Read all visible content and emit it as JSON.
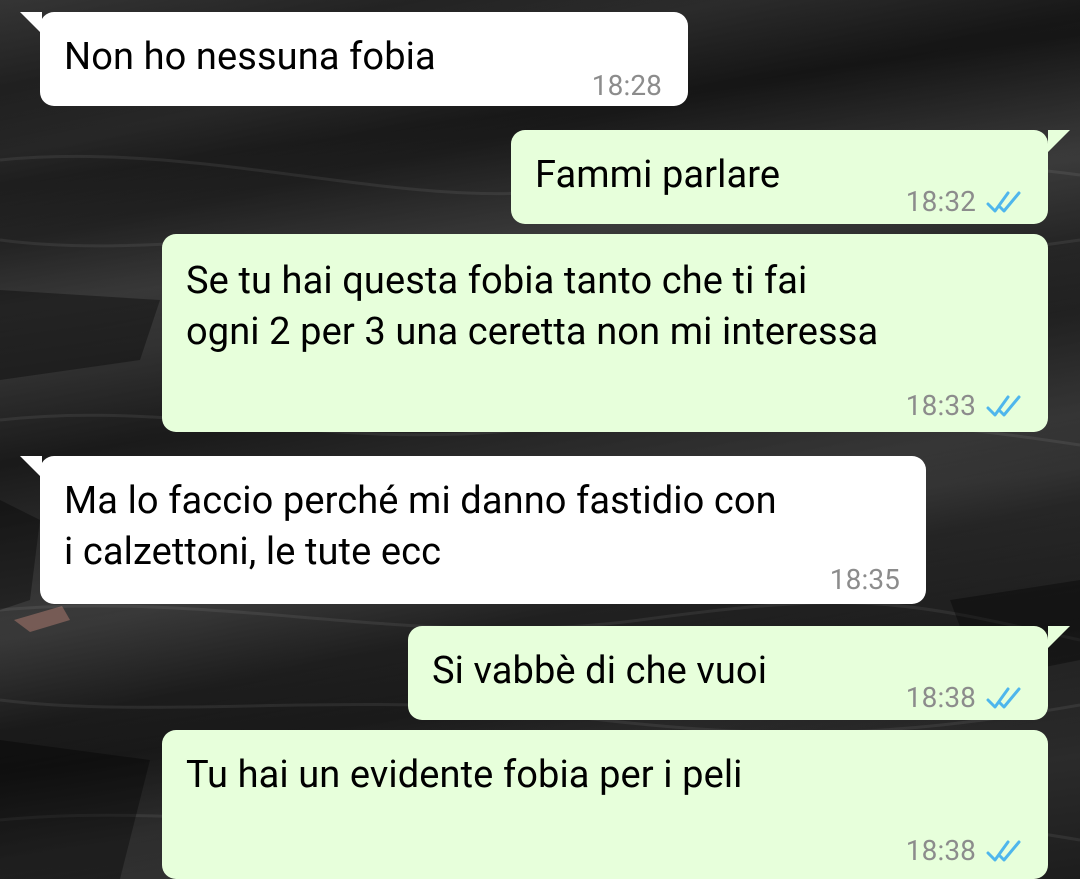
{
  "chat": {
    "messages": [
      {
        "direction": "incoming",
        "text": "Non ho nessuna fobia",
        "time": "18:28"
      },
      {
        "direction": "outgoing",
        "text": "Fammi parlare",
        "time": "18:32",
        "status": "read-double-tick-icon"
      },
      {
        "direction": "outgoing",
        "text": "Se tu hai questa fobia tanto che ti fai\nogni 2 per 3 una ceretta non mi interessa",
        "time": "18:33",
        "status": "read-double-tick-icon"
      },
      {
        "direction": "incoming",
        "text": "Ma lo faccio perché mi danno fastidio con\ni calzettoni, le tute ecc",
        "time": "18:35"
      },
      {
        "direction": "outgoing",
        "text": "Si vabbè di che vuoi",
        "time": "18:38",
        "status": "read-double-tick-icon"
      },
      {
        "direction": "outgoing",
        "text": "Tu hai un evidente fobia per i peli",
        "time": "18:38",
        "status": "read-double-tick-icon"
      }
    ]
  },
  "colors": {
    "incoming_bubble": "#ffffff",
    "outgoing_bubble": "#e7ffdb",
    "timestamp": "#8c8c8c",
    "read_tick": "#4fb6ec",
    "wallpaper": "#1b1b1b"
  }
}
